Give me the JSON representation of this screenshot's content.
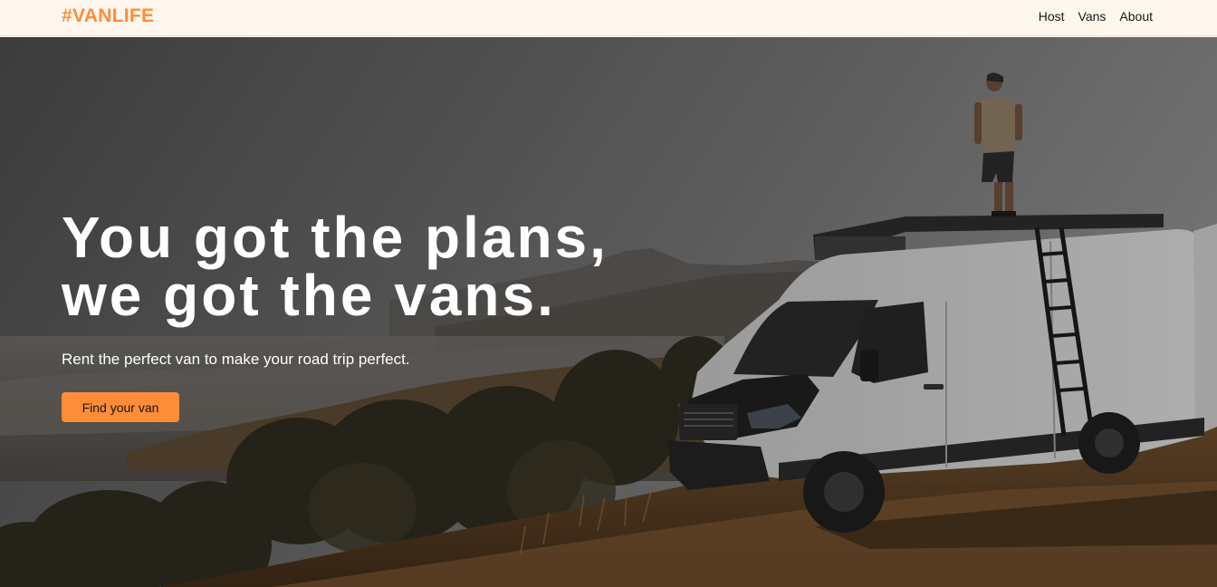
{
  "header": {
    "logo": "#VANLIFE",
    "nav": [
      "Host",
      "Vans",
      "About"
    ]
  },
  "hero": {
    "headline_line1": "You got the plans,",
    "headline_line2": "we got the vans.",
    "subline": "Rent the perfect van to make your road trip perfect.",
    "cta_label": "Find your van"
  },
  "colors": {
    "accent": "#FF8C38",
    "header_bg": "#FFF7ED",
    "text_dark": "#161616",
    "hero_text": "#FFFFFF"
  }
}
